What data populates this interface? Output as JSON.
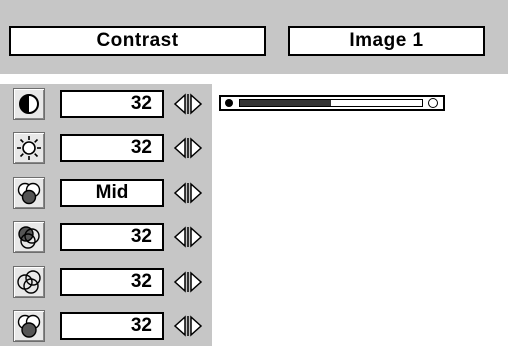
{
  "header": {
    "title": "Contrast",
    "mode": "Image 1"
  },
  "rows": [
    {
      "icon": "contrast-icon",
      "value": "32"
    },
    {
      "icon": "brightness-icon",
      "value": "32"
    },
    {
      "icon": "color-temp-icon",
      "value": "Mid"
    },
    {
      "icon": "red-adjust-icon",
      "value": "32"
    },
    {
      "icon": "green-adjust-icon",
      "value": "32"
    },
    {
      "icon": "blue-adjust-icon",
      "value": "32"
    }
  ],
  "slider": {
    "level_fraction": 0.5
  }
}
